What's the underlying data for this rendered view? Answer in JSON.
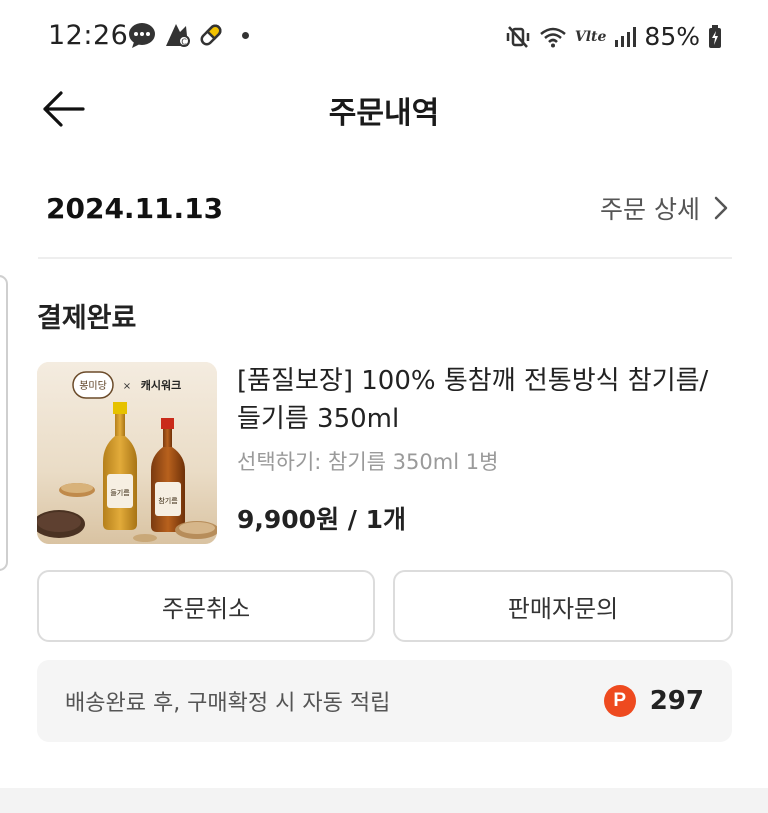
{
  "status_bar": {
    "time": "12:26",
    "battery_percent": "85%",
    "network_label": "Vlte"
  },
  "header": {
    "title": "주문내역"
  },
  "order": {
    "date": "2024.11.13",
    "detail_link_label": "주문 상세",
    "status": "결제완료",
    "product": {
      "name": "[품질보장] 100% 통참깨 전통방식 참기름/들기름 350ml",
      "option": "선택하기: 참기름 350ml 1병",
      "price": "9,900원 / 1개",
      "image_brand_left": "봉미당",
      "image_brand_x": "×",
      "image_brand_right": "캐시워크",
      "bottle_label_left": "들기름",
      "bottle_label_right": "참기름"
    },
    "buttons": {
      "cancel_label": "주문취소",
      "inquiry_label": "판매자문의"
    },
    "points": {
      "text": "배송완료 후, 구매확정 시 자동 적립",
      "icon_letter": "P",
      "value": "297",
      "icon_color": "#ee4a1f"
    }
  }
}
